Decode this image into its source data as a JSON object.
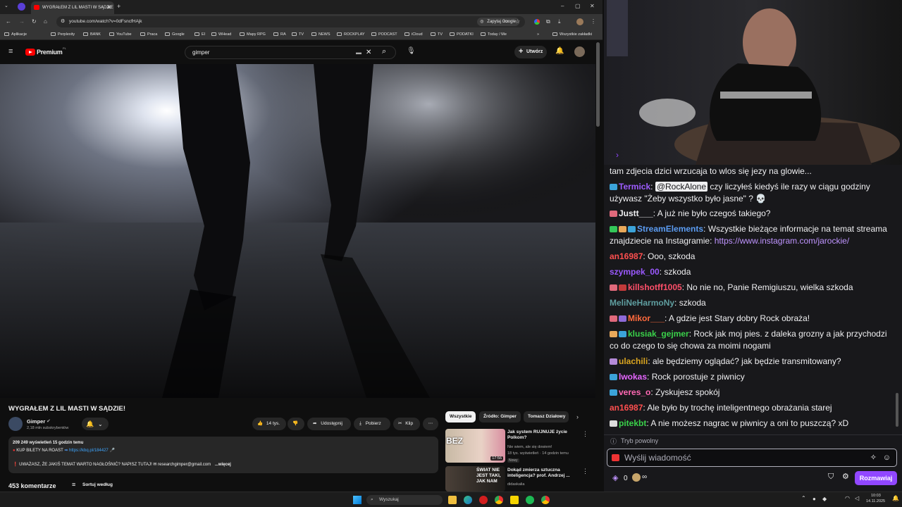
{
  "browser": {
    "tab_title": "WYGRAŁEM Z LIL MASTI W SĄDZIE",
    "url": "youtube.com/watch?v=0dFsncfHAjk",
    "google_btn": "Zapytaj Google",
    "bookmarks": [
      "Aplikacje",
      "Perplexity",
      "BANK",
      "YouTube",
      "Praca",
      "Google",
      "EI",
      "WHead",
      "Mapy RPG",
      "RA",
      "TV",
      "NEWS",
      "ROCKPLAY",
      "PODCAST",
      "iCloud",
      "TV",
      "PODATKI",
      "Today / Me"
    ],
    "bookmarks_all": "Wszystkie zakładki"
  },
  "youtube": {
    "logo_text": "Premium",
    "logo_sup": "PL",
    "search_value": "gimper",
    "create_label": "Utwórz",
    "video_title": "WYGRAŁEM Z LIL MASTI W SĄDZIE!",
    "channel_name": "Gimper",
    "subscribers": "2,18 mln subskrybentów",
    "likes": "14 tys.",
    "share_label": "Udostępnij",
    "download_label": "Pobierz",
    "clip_label": "Klip",
    "views_line": "209 249 wyświetleń  15 godzin temu",
    "desc_line1": "KUP BILETY NA ROAST",
    "desc_link": "https://kbq.pl/184427",
    "desc_line2": "UWAŻASZ, ŻE JAKIŚ TEMAT WARTO NAGŁOŚNIĆ? NAPISZ TUTAJ!",
    "desc_email": "researchgimper@gmail.com",
    "desc_more": "...więcej",
    "comments_count": "453 komentarze",
    "sort_label": "Sortuj według",
    "chips": [
      "Wszystkie",
      "Źródło: Gimper",
      "Tomasz Działowy"
    ],
    "recs": [
      {
        "title": "Jak system RUJNUJE życie Polkom?",
        "channel": "Nie wiem, ale się dowiem!",
        "meta": "18 tys. wyświetleń · 14 godzin temu",
        "badge": "Nowy",
        "duration": "17:56",
        "thumb_text": "BEZ"
      },
      {
        "title": "Dokąd zmierza sztuczna inteligencja? prof. Andrzej ...",
        "channel": "didaskalia",
        "meta": "",
        "badge": "",
        "duration": "",
        "thumb_text": "ŚWIAT NIE JEST TAKI, JAK NAM"
      }
    ]
  },
  "chat": {
    "messages": [
      {
        "user": "",
        "color": "#efeff1",
        "text": "tam zdjecia dzici wrzucaja to wlos się jezy na glowie...",
        "mention": ""
      },
      {
        "user": "Termick",
        "color": "#9d5cff",
        "text": " czy liczyłeś kiedyś ile razy w ciągu godziny używasz \"Żeby wszystko było jasne\" ?",
        "mention": "@RockAlone"
      },
      {
        "user": "Justt___",
        "color": "#efeff1",
        "text": ": A już nie było czegoś takiego?",
        "mention": ""
      },
      {
        "user": "StreamElements",
        "color": "#5b9cf2",
        "text": ": Wszystkie bieżące informacje na temat streama znajdziecie na Instagramie: ",
        "link": "https://www.instagram.com/jarockie/",
        "mention": ""
      },
      {
        "user": "an16987",
        "color": "#ff4f4f",
        "text": ": Ooo, szkoda",
        "mention": ""
      },
      {
        "user": "szympek_00",
        "color": "#9b59ff",
        "text": ": szkoda",
        "mention": ""
      },
      {
        "user": "killshotff1005",
        "color": "#ff4f6a",
        "text": ": No nie no, Panie Remigiuszu, wielka szkoda",
        "mention": ""
      },
      {
        "user": "MeliNeHarmoNy",
        "color": "#5f9ea0",
        "text": ": szkoda",
        "mention": ""
      },
      {
        "user": "Mikor___",
        "color": "#ff6a3d",
        "text": ": A gdzie jest Stary dobry Rock obraża!",
        "mention": ""
      },
      {
        "user": "klusiak_gejmer",
        "color": "#3ad14a",
        "text": ": Rock jak moj pies. z daleka grozny a jak przychodzi co do czego to się chowa za moimi nogami",
        "mention": ""
      },
      {
        "user": "ulachili",
        "color": "#daa520",
        "text": ": ale będziemy oglądać? jak będzie transmitowany?",
        "mention": ""
      },
      {
        "user": "lwokas",
        "color": "#e667ff",
        "text": ": Rock porostuje z piwnicy",
        "mention": ""
      },
      {
        "user": "veres_o",
        "color": "#ff69b4",
        "text": ": Zyskujesz spokój",
        "mention": ""
      },
      {
        "user": "an16987",
        "color": "#ff4f4f",
        "text": ": Ale było by trochę inteligentnego obrażania starej",
        "mention": ""
      },
      {
        "user": "pitekbt",
        "color": "#3ad14a",
        "text": ": A nie możesz nagrac w piwnicy a oni to puszczą? xD",
        "mention": ""
      }
    ],
    "slow_mode": "Tryb powolny",
    "input_placeholder": "Wyślij wiadomość",
    "points": "0",
    "send_label": "Rozmawiaj"
  },
  "taskbar": {
    "search_label": "Wyszukaj",
    "time": "10:03",
    "date": "14.11.2025"
  }
}
